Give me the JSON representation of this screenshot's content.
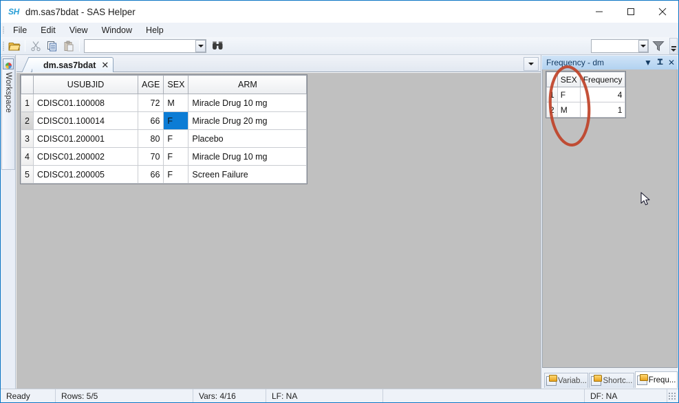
{
  "window": {
    "logo": "SH",
    "title": "dm.sas7bdat - SAS Helper",
    "minimize": "—",
    "maximize": "□",
    "close": "✕"
  },
  "menu": {
    "items": [
      {
        "label": "File"
      },
      {
        "label": "Edit"
      },
      {
        "label": "View"
      },
      {
        "label": "Window"
      },
      {
        "label": "Help"
      }
    ]
  },
  "toolbar": {
    "open_icon": "open-folder-icon",
    "cut_icon": "scissors-icon",
    "copy_icon": "copy-icon",
    "paste_icon": "paste-icon",
    "find_icon": "binoculars-icon",
    "filter_icon": "funnel-icon",
    "search_value": "",
    "search_placeholder": "",
    "filter_value": "",
    "filter_placeholder": "",
    "overflow_label": ""
  },
  "left_dock": {
    "workspace_tab": "Workspace"
  },
  "tabs": {
    "document_tab": "dm.sas7bdat",
    "close_glyph": "✕",
    "tablist_glyph": "▼"
  },
  "grid": {
    "columns": [
      "USUBJID",
      "AGE",
      "SEX",
      "ARM"
    ],
    "rows": [
      {
        "n": "1",
        "USUBJID": "CDISC01.100008",
        "AGE": "72",
        "SEX": "M",
        "ARM": "Miracle Drug 10 mg"
      },
      {
        "n": "2",
        "USUBJID": "CDISC01.100014",
        "AGE": "66",
        "SEX": "F",
        "ARM": "Miracle Drug 20 mg"
      },
      {
        "n": "3",
        "USUBJID": "CDISC01.200001",
        "AGE": "80",
        "SEX": "F",
        "ARM": "Placebo"
      },
      {
        "n": "4",
        "USUBJID": "CDISC01.200002",
        "AGE": "70",
        "SEX": "F",
        "ARM": "Miracle Drug 10 mg"
      },
      {
        "n": "5",
        "USUBJID": "CDISC01.200005",
        "AGE": "66",
        "SEX": "F",
        "ARM": "Screen Failure"
      }
    ],
    "selected_cell": {
      "row": 2,
      "column": "SEX",
      "value": "F"
    },
    "selection_color": "#0c7cd5"
  },
  "panel": {
    "title": "Frequency - dm",
    "dropdown_glyph": "▼",
    "pin_glyph": "⊥",
    "close_glyph": "✕",
    "table": {
      "columns": [
        "SEX",
        "Frequency"
      ],
      "rows": [
        {
          "n": "1",
          "SEX": "F",
          "Frequency": "4"
        },
        {
          "n": "2",
          "SEX": "M",
          "Frequency": "1"
        }
      ]
    },
    "tabs": [
      {
        "label": "Variab...",
        "active": false
      },
      {
        "label": "Shortc...",
        "active": false
      },
      {
        "label": "Frequ...",
        "active": true
      }
    ]
  },
  "annotation": {
    "type": "hand-drawn-ellipse",
    "color": "#c0402a",
    "target": "SEX column of frequency table"
  },
  "statusbar": {
    "ready": "Ready",
    "rows": "Rows: 5/5",
    "vars": "Vars: 4/16",
    "lf": "LF: NA",
    "df": "DF: NA"
  }
}
